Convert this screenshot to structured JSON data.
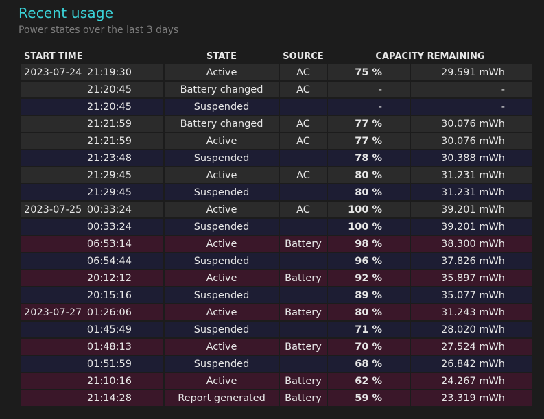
{
  "header": {
    "title": "Recent usage",
    "subtitle": "Power states over the last 3 days"
  },
  "table": {
    "columns": [
      "START TIME",
      "STATE",
      "SOURCE",
      "CAPACITY REMAINING"
    ],
    "rows": [
      {
        "date": "2023-07-24",
        "time": "21:19:30",
        "state": "Active",
        "source": "AC",
        "percent": "75 %",
        "mwh": "29.591 mWh",
        "kind": "ac"
      },
      {
        "date": "",
        "time": "21:20:45",
        "state": "Battery changed",
        "source": "AC",
        "percent": "-",
        "mwh": "-",
        "kind": "ac"
      },
      {
        "date": "",
        "time": "21:20:45",
        "state": "Suspended",
        "source": "",
        "percent": "-",
        "mwh": "-",
        "kind": "susp"
      },
      {
        "date": "",
        "time": "21:21:59",
        "state": "Battery changed",
        "source": "AC",
        "percent": "77 %",
        "mwh": "30.076 mWh",
        "kind": "ac"
      },
      {
        "date": "",
        "time": "21:21:59",
        "state": "Active",
        "source": "AC",
        "percent": "77 %",
        "mwh": "30.076 mWh",
        "kind": "ac"
      },
      {
        "date": "",
        "time": "21:23:48",
        "state": "Suspended",
        "source": "",
        "percent": "78 %",
        "mwh": "30.388 mWh",
        "kind": "susp"
      },
      {
        "date": "",
        "time": "21:29:45",
        "state": "Active",
        "source": "AC",
        "percent": "80 %",
        "mwh": "31.231 mWh",
        "kind": "ac"
      },
      {
        "date": "",
        "time": "21:29:45",
        "state": "Suspended",
        "source": "",
        "percent": "80 %",
        "mwh": "31.231 mWh",
        "kind": "susp"
      },
      {
        "date": "2023-07-25",
        "time": "00:33:24",
        "state": "Active",
        "source": "AC",
        "percent": "100 %",
        "mwh": "39.201 mWh",
        "kind": "ac"
      },
      {
        "date": "",
        "time": "00:33:24",
        "state": "Suspended",
        "source": "",
        "percent": "100 %",
        "mwh": "39.201 mWh",
        "kind": "susp"
      },
      {
        "date": "",
        "time": "06:53:14",
        "state": "Active",
        "source": "Battery",
        "percent": "98 %",
        "mwh": "38.300 mWh",
        "kind": "batt"
      },
      {
        "date": "",
        "time": "06:54:44",
        "state": "Suspended",
        "source": "",
        "percent": "96 %",
        "mwh": "37.826 mWh",
        "kind": "susp"
      },
      {
        "date": "",
        "time": "20:12:12",
        "state": "Active",
        "source": "Battery",
        "percent": "92 %",
        "mwh": "35.897 mWh",
        "kind": "batt"
      },
      {
        "date": "",
        "time": "20:15:16",
        "state": "Suspended",
        "source": "",
        "percent": "89 %",
        "mwh": "35.077 mWh",
        "kind": "susp"
      },
      {
        "date": "2023-07-27",
        "time": "01:26:06",
        "state": "Active",
        "source": "Battery",
        "percent": "80 %",
        "mwh": "31.243 mWh",
        "kind": "batt"
      },
      {
        "date": "",
        "time": "01:45:49",
        "state": "Suspended",
        "source": "",
        "percent": "71 %",
        "mwh": "28.020 mWh",
        "kind": "susp"
      },
      {
        "date": "",
        "time": "01:48:13",
        "state": "Active",
        "source": "Battery",
        "percent": "70 %",
        "mwh": "27.524 mWh",
        "kind": "batt"
      },
      {
        "date": "",
        "time": "01:51:59",
        "state": "Suspended",
        "source": "",
        "percent": "68 %",
        "mwh": "26.842 mWh",
        "kind": "susp"
      },
      {
        "date": "",
        "time": "21:10:16",
        "state": "Active",
        "source": "Battery",
        "percent": "62 %",
        "mwh": "24.267 mWh",
        "kind": "batt"
      },
      {
        "date": "",
        "time": "21:14:28",
        "state": "Report generated",
        "source": "Battery",
        "percent": "59 %",
        "mwh": "23.319 mWh",
        "kind": "batt"
      }
    ]
  },
  "colors": {
    "title": "#3ad1d6",
    "row_ac": "#2b2b2b",
    "row_suspended": "#1d1d33",
    "row_battery": "#3a1729"
  }
}
